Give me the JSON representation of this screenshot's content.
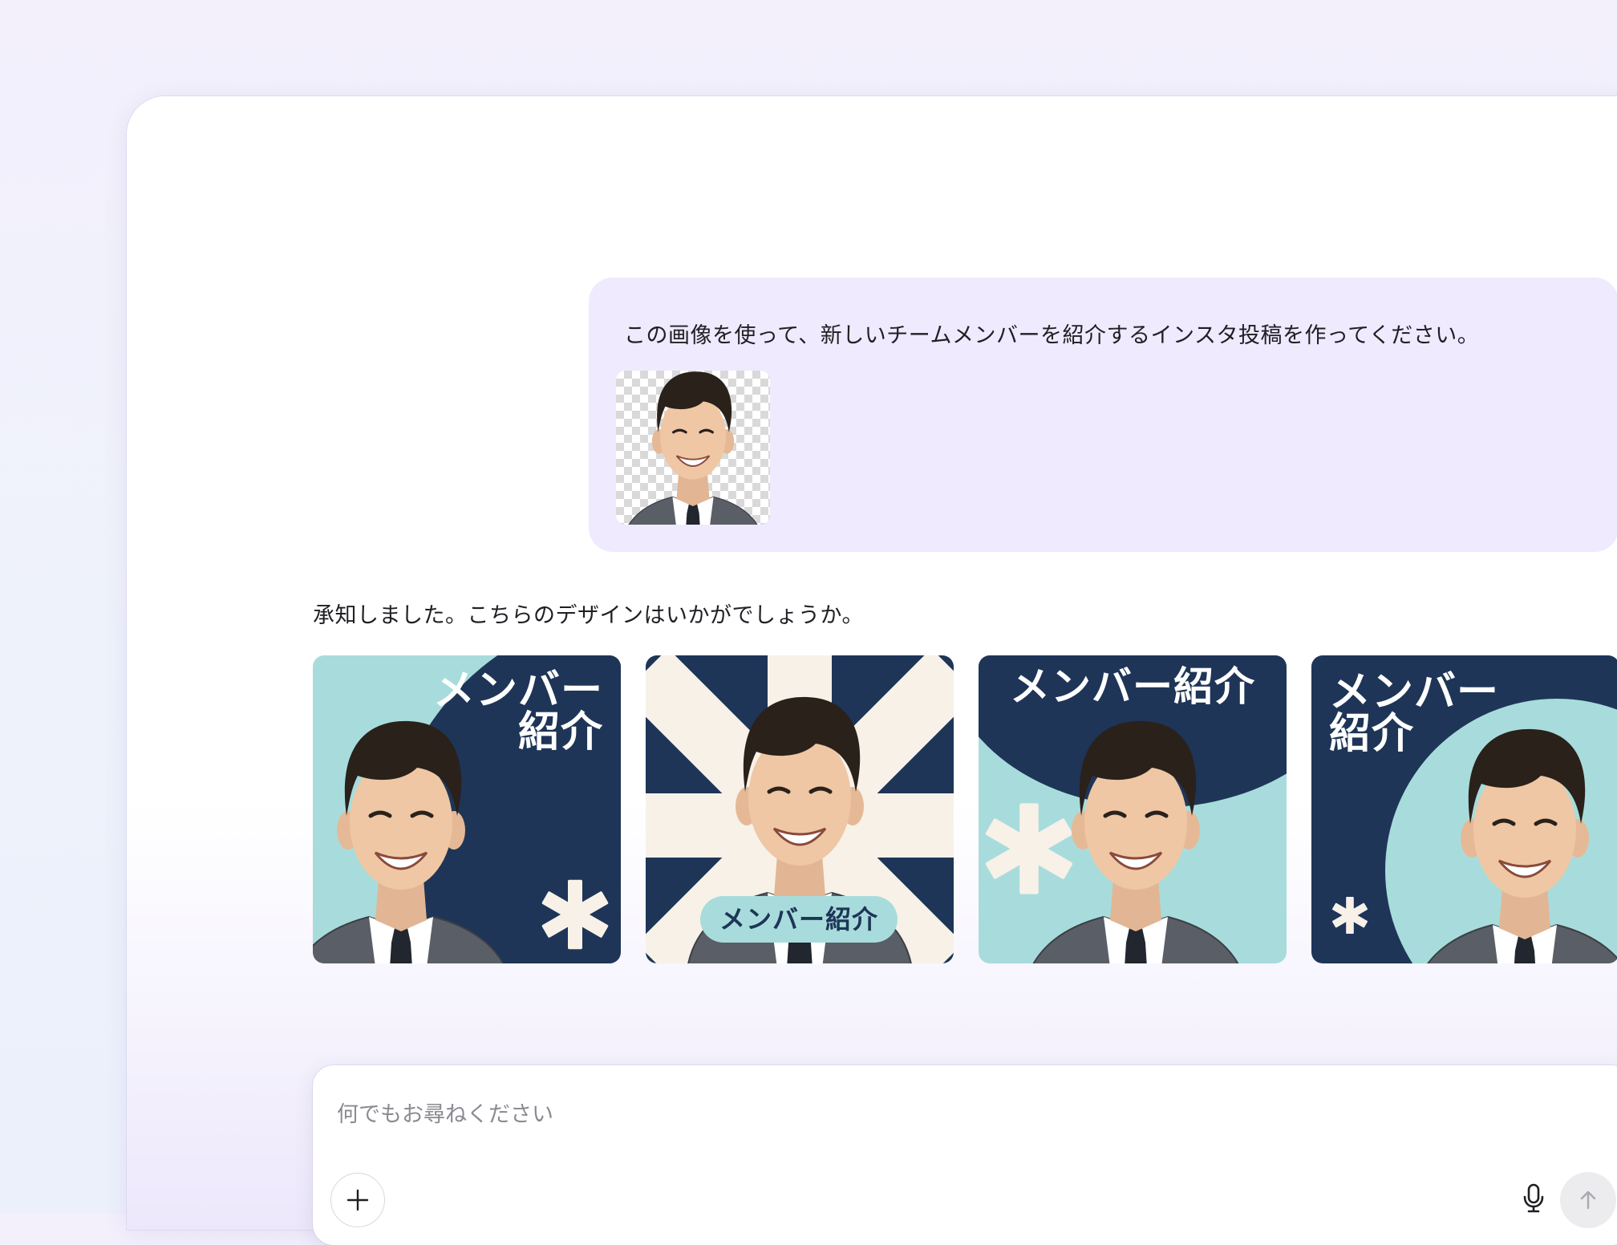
{
  "conversation": {
    "user_message": "この画像を使って、新しいチームメンバーを紹介するインスタ投稿を作ってください。",
    "assistant_message": "承知しました。こちらのデザインはいかがでしょうか。"
  },
  "designs": [
    {
      "label_line1": "メンバー",
      "label_line2": "紹介"
    },
    {
      "pill_label": "メンバー紹介"
    },
    {
      "label": "メンバー紹介"
    },
    {
      "label_line1": "メンバー",
      "label_line2": "紹介"
    }
  ],
  "composer": {
    "placeholder": "何でもお尋ねください"
  },
  "colors": {
    "navy": "#1e3558",
    "teal": "#a8dcdc",
    "cream": "#f7f1e8",
    "bubble": "#efeafd"
  },
  "icons": [
    "plus-icon",
    "microphone-icon",
    "arrow-up-icon",
    "asterisk-icon"
  ]
}
